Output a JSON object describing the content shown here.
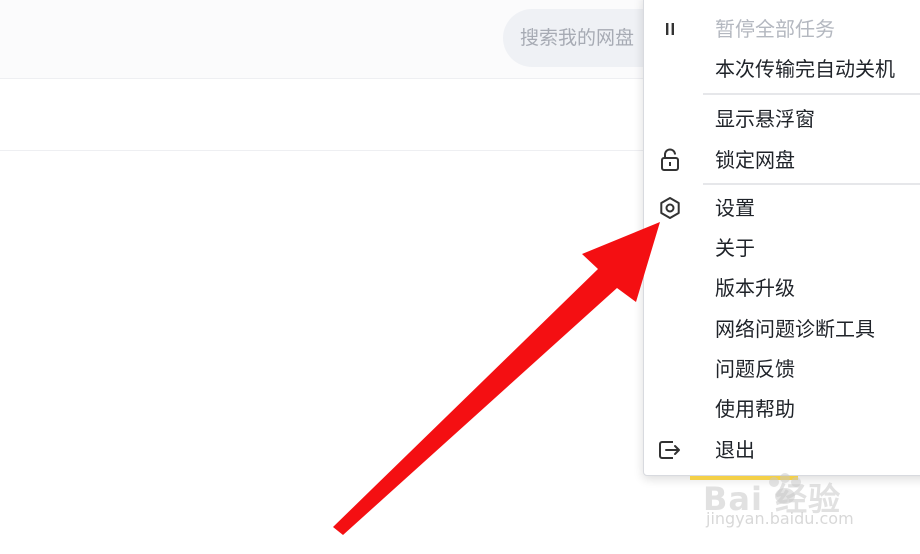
{
  "search": {
    "placeholder": "搜索我的网盘"
  },
  "menu": {
    "items": [
      {
        "label": "暂停全部任务",
        "icon": "pause-icon",
        "disabled": true
      },
      {
        "label": "本次传输完自动关机"
      },
      {
        "label": "显示悬浮窗"
      },
      {
        "label": "锁定网盘",
        "icon": "lock-icon"
      },
      {
        "label": "设置",
        "icon": "gear-icon"
      },
      {
        "label": "关于"
      },
      {
        "label": "版本升级"
      },
      {
        "label": "网络问题诊断工具"
      },
      {
        "label": "问题反馈"
      },
      {
        "label": "使用帮助"
      },
      {
        "label": "退出",
        "icon": "exit-icon"
      }
    ]
  },
  "watermark": {
    "brand": "Bai 经验",
    "url": "jingyan.baidu.com"
  },
  "colors": {
    "arrow": "#f40f12",
    "menu_text": "#1f2329",
    "disabled_text": "#b4b8c0"
  }
}
